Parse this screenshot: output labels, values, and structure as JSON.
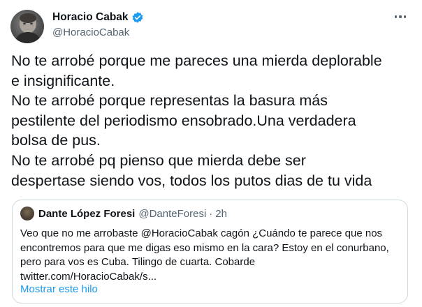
{
  "tweet": {
    "author": {
      "display_name": "Horacio Cabak",
      "handle": "@HoracioCabak",
      "verified": true
    },
    "text": "No te arrobé porque me pareces una mierda deplorable\ne insignificante.\nNo te arrobé porque representas la basura más\npestilente del periodismo ensobrado.Una verdadera\nbolsa de pus.\nNo te arrobé pq pienso que mierda debe ser\ndespertase siendo vos, todos los putos dias de tu vida",
    "more_icon": "more-dots-icon"
  },
  "quote": {
    "author": {
      "display_name": "Dante López Foresi",
      "handle": "@DanteForesi",
      "separator": "·",
      "time": "2h"
    },
    "text": "Veo que no me arrobaste @HoracioCabak cagón ¿Cuándo te parece que nos\nencontremos para que me digas eso mismo en la cara? Estoy en el conurbano,\npero para vos es Cuba. Tilingo de cuarta. Cobarde\ntwitter.com/HoracioCabak/s...",
    "show_thread": "Mostrar este hilo"
  },
  "colors": {
    "link": "#1d9bf0",
    "secondary_text": "#536471",
    "border": "#cfd9de",
    "verified_badge": "#1d9bf0"
  }
}
